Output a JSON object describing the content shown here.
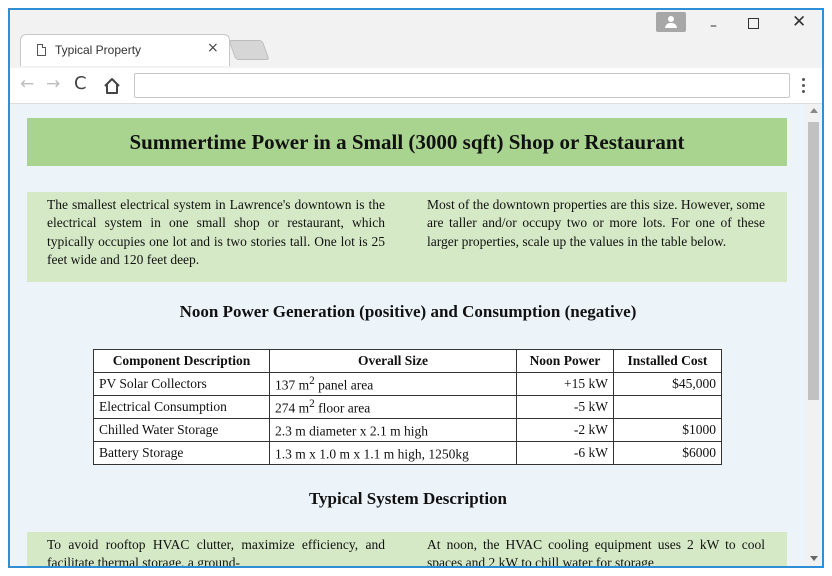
{
  "browser": {
    "tab_title": "Typical Property",
    "tab_close": "×",
    "nav_back": "←",
    "nav_forward": "→",
    "nav_reload": "C",
    "window_minimize": "–",
    "window_close": "✕",
    "address_value": ""
  },
  "page": {
    "title": "Summertime Power in a Small (3000 sqft) Shop or Restaurant",
    "intro_left": "The smallest electrical system in Lawrence's downtown is the electrical system in one small shop or restaurant, which typically occupies one lot and is two stories tall. One lot is 25 feet wide and 120 feet deep.",
    "intro_right": "Most of the downtown properties are this size. However, some are taller and/or occupy two or more lots. For one of these larger properties, scale up the values in the table below.",
    "table_heading": "Noon Power Generation (positive) and Consumption (negative)",
    "table": {
      "headers": [
        "Component Description",
        "Overall Size",
        "Noon Power",
        "Installed Cost"
      ],
      "rows": [
        {
          "component": "PV Solar Collectors",
          "size_pre": "137 m",
          "size_sup": "2",
          "size_post": " panel area",
          "power": "+15 kW",
          "cost": "$45,000"
        },
        {
          "component": "Electrical Consumption",
          "size_pre": "274 m",
          "size_sup": "2",
          "size_post": " floor area",
          "power": "-5 kW",
          "cost": ""
        },
        {
          "component": "Chilled Water Storage",
          "size_pre": "2.3 m diameter x 2.1 m high",
          "size_sup": "",
          "size_post": "",
          "power": "-2 kW",
          "cost": "$1000"
        },
        {
          "component": "Battery Storage",
          "size_pre": "1.3 m x 1.0 m x 1.1 m high, 1250kg",
          "size_sup": "",
          "size_post": "",
          "power": "-6 kW",
          "cost": "$6000"
        }
      ]
    },
    "system_heading": "Typical System Description",
    "system_left": "To avoid rooftop HVAC clutter, maximize efficiency, and facilitate thermal storage, a ground-",
    "system_right": "At noon, the HVAC cooling equipment uses 2 kW to cool spaces and 2 kW to chill water for storage"
  },
  "colors": {
    "title_banner": "#a9d48f",
    "text_band": "#d5e9c6",
    "page_background": "#edf4f9",
    "window_border": "#2e8fd6"
  }
}
